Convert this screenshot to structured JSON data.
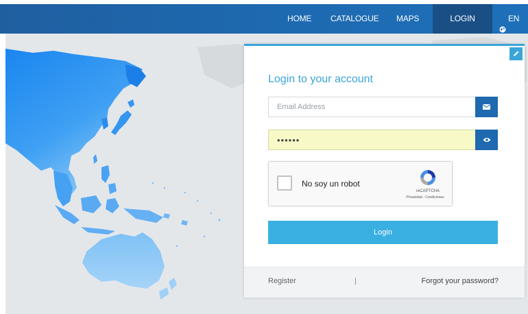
{
  "nav": {
    "home": "HOME",
    "catalogue": "CATALOGUE",
    "maps": "MAPS",
    "login": "LOGIN",
    "language": "EN"
  },
  "login_form": {
    "title": "Login to your account",
    "email_placeholder": "Email Address",
    "email_value": "",
    "password_value": "••••••",
    "captcha_label": "No soy un robot",
    "captcha_brand": "reCAPTCHA",
    "captcha_links": "Privacidad - Condiciones",
    "submit_label": "Login"
  },
  "footer": {
    "register": "Register",
    "separator": "|",
    "forgot": "Forgot your password?"
  },
  "colors": {
    "navbar": "#1e69b0",
    "accent": "#3aa5d9",
    "login_button": "#3ab0e2",
    "password_autofill_bg": "#f7f9c7"
  },
  "icons": {
    "language": "globe-icon",
    "email_button": "envelope-icon",
    "password_button": "eye-icon",
    "card_corner": "pencil-icon",
    "captcha": "recaptcha-logo-icon"
  }
}
